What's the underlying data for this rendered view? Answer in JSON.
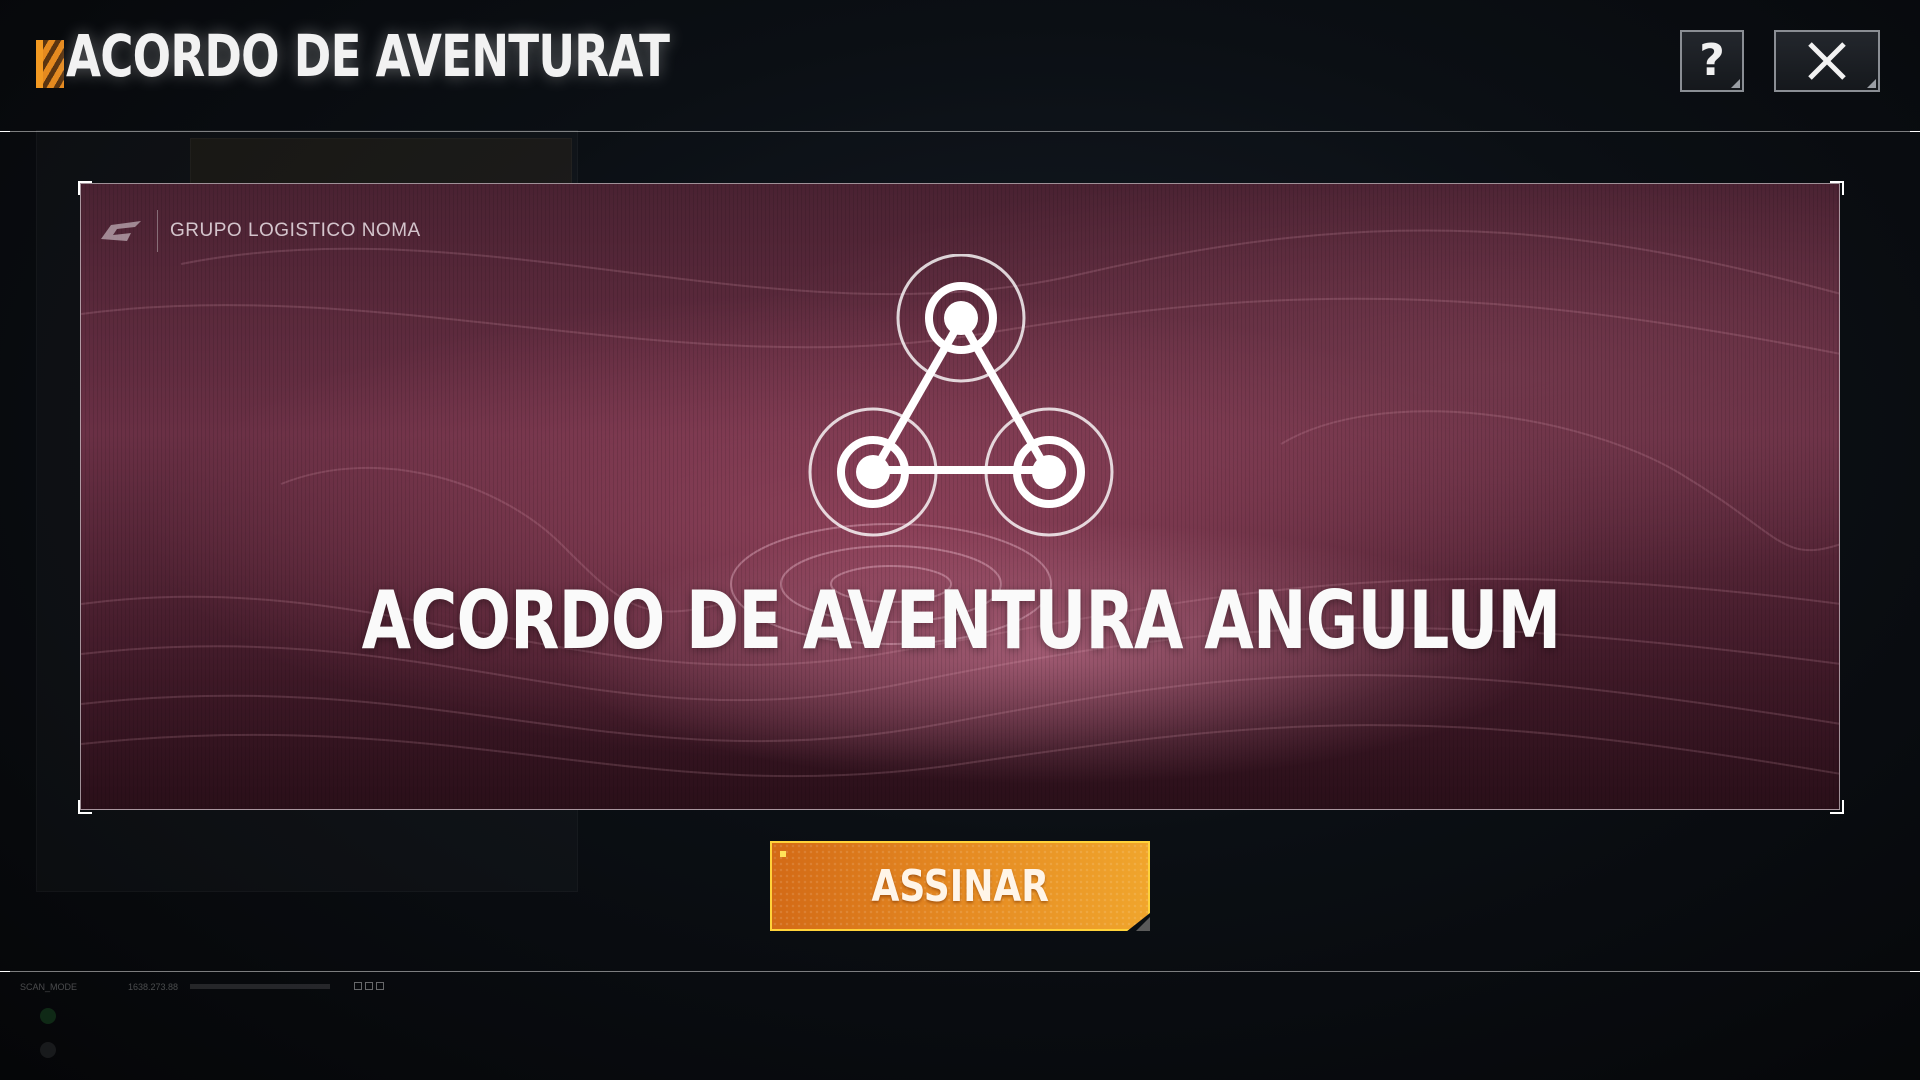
{
  "header": {
    "title": "ACORDO DE AVENTURAT",
    "help_icon": "question-mark-icon",
    "close_icon": "close-x-icon"
  },
  "banner": {
    "brand_logo": "noma-logo-icon",
    "brand_name": "GRUPO LOGISTICO NOMA",
    "emblem_icon": "triangle-network-icon",
    "title": "ACORDO DE AVENTURA ANGULUM"
  },
  "actions": {
    "sign_label": "ASSINAR"
  },
  "status": {
    "mode": "SCAN_MODE",
    "readout": "1638.273.88"
  },
  "colors": {
    "accent_orange": "#f39a22",
    "button_border": "#ffd23a",
    "banner_tint": "#6a3045"
  }
}
